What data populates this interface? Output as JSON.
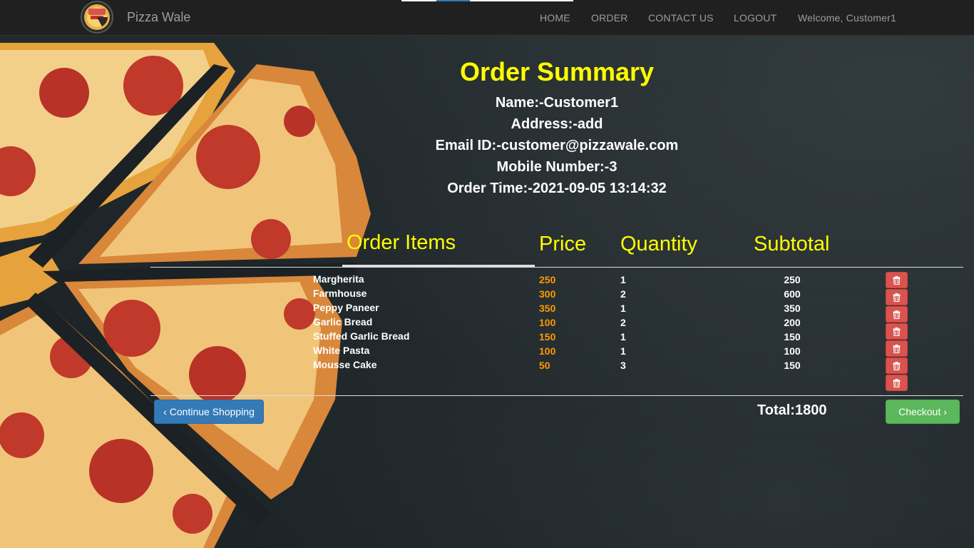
{
  "brand": {
    "name": "Pizza Wale"
  },
  "nav": {
    "items": [
      "HOME",
      "ORDER",
      "CONTACT US",
      "LOGOUT"
    ],
    "welcome": "Welcome, Customer1"
  },
  "summary": {
    "title": "Order Summary",
    "name": "Name:-Customer1",
    "address": "Address:-add",
    "email": "Email ID:-customer@pizzawale.com",
    "mobile": "Mobile Number:-3",
    "order_time": "Order Time:-2021-09-05 13:14:32"
  },
  "table": {
    "headers": [
      "Order Items",
      "Price",
      "Quantity",
      "Subtotal"
    ],
    "rows": [
      {
        "item": "Margherita",
        "price": "250",
        "qty": "1",
        "subtotal": "250"
      },
      {
        "item": "Farmhouse",
        "price": "300",
        "qty": "2",
        "subtotal": "600"
      },
      {
        "item": "Peppy Paneer",
        "price": "350",
        "qty": "1",
        "subtotal": "350"
      },
      {
        "item": "Garlic Bread",
        "price": "100",
        "qty": "2",
        "subtotal": "200"
      },
      {
        "item": "Stuffed Garlic Bread",
        "price": "150",
        "qty": "1",
        "subtotal": "150"
      },
      {
        "item": "White Pasta",
        "price": "100",
        "qty": "1",
        "subtotal": "100"
      },
      {
        "item": "Mousse Cake",
        "price": "50",
        "qty": "3",
        "subtotal": "150"
      }
    ]
  },
  "footer": {
    "continue_label": "Continue Shopping",
    "total": "Total:1800",
    "checkout_label": "Checkout"
  },
  "colors": {
    "accent_yellow": "#ffff00",
    "price_orange": "#ff9900",
    "delete_red": "#d9534f",
    "primary_blue": "#337ab7",
    "success_green": "#5cb85c",
    "navbar": "#202020"
  },
  "icons": {
    "delete": "trash-icon",
    "continue": "chevron-left-icon",
    "checkout": "chevron-right-icon"
  }
}
